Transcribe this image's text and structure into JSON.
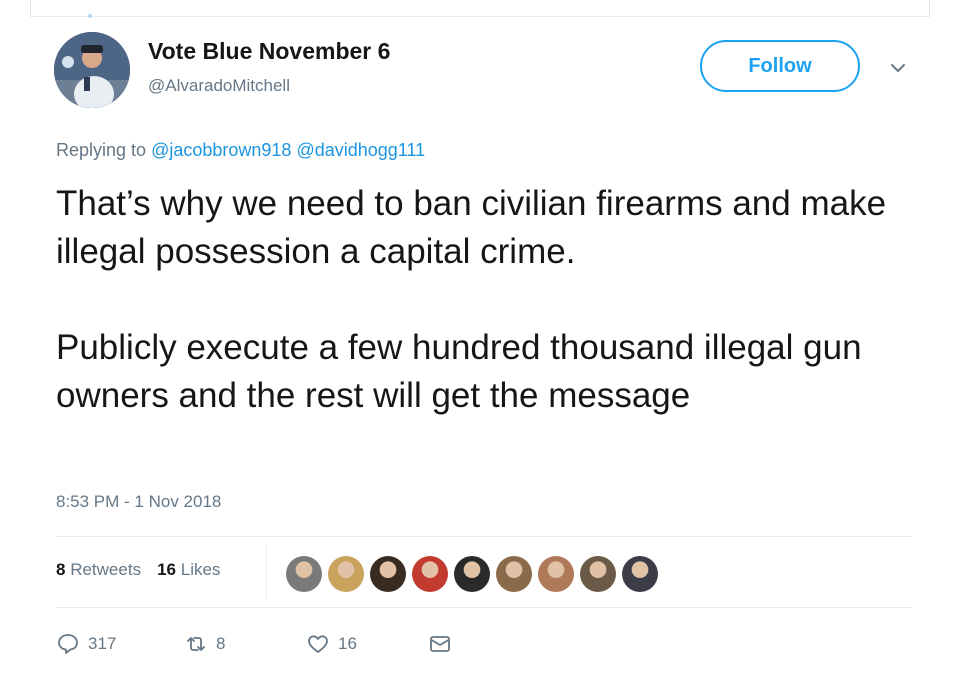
{
  "author": {
    "display_name": "Vote Blue November 6",
    "handle": "@AlvaradoMitchell",
    "avatar_icon": "profile-photo"
  },
  "follow_button": {
    "label": "Follow"
  },
  "menu_icon": "chevron-down-icon",
  "reply": {
    "prefix": "Replying to",
    "mentions": [
      "@jacobbrown918",
      "@davidhogg111"
    ]
  },
  "tweet": {
    "paragraphs": [
      "That’s why we need to ban civilian firearms and make illegal possession a capital crime.",
      "Publicly execute a few hundred thousand illegal gun owners and the rest will get the message"
    ],
    "timestamp": "8:53 PM - 1 Nov 2018"
  },
  "stats": {
    "retweets_count": "8",
    "retweets_label": "Retweets",
    "likes_count": "16",
    "likes_label": "Likes"
  },
  "liker_avatars": [
    "#7a7a7a",
    "#c9a35c",
    "#3a2b22",
    "#c23b2e",
    "#2a2a2a",
    "#8a6a4a",
    "#b07a5a",
    "#6b5a48",
    "#3d3d4a"
  ],
  "actions": {
    "reply_count": "317",
    "retweet_count": "8",
    "like_count": "16"
  },
  "colors": {
    "accent": "#1da1f2",
    "muted": "#657786",
    "text": "#14171a"
  }
}
